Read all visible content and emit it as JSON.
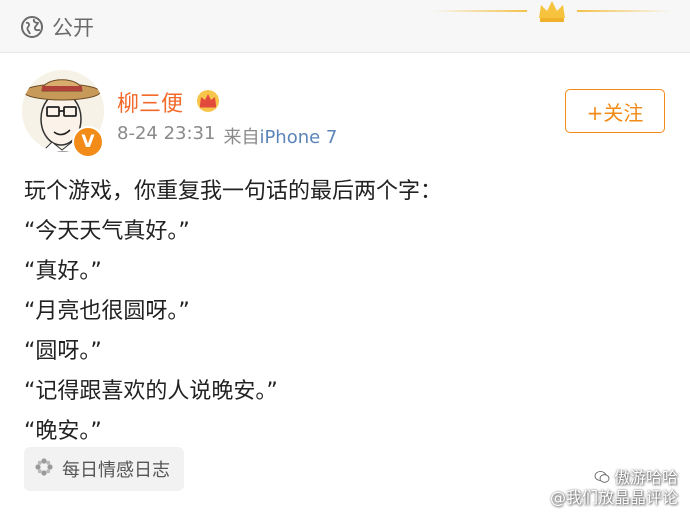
{
  "header": {
    "visibility_label": "公开",
    "visibility_icon": "globe-icon",
    "decor_icon": "crown-icon"
  },
  "post": {
    "author": {
      "name": "柳三便",
      "verified_badge": "V",
      "avatar": "avatar-cartoon-man-with-hat",
      "vip_icon": "crown-badge-icon"
    },
    "date": "8-24 23:31",
    "source": "来自",
    "device": "iPhone 7",
    "follow_label": "+关注",
    "content_lines": [
      "玩个游戏，你重复我一句话的最后两个字：",
      "“今天天气真好。”",
      "“真好。”",
      "“月亮也很圆呀。”",
      "“圆呀。”",
      "“记得跟喜欢的人说晚安。”",
      "“晚安。”"
    ],
    "topic_tag": "每日情感日志",
    "topic_icon": "pinwheel-icon"
  },
  "watermark": {
    "line1": "傲游哈哈",
    "line2": "@我们放晶晶评论"
  },
  "colors": {
    "accent": "#f28b18",
    "name": "#f26a2a",
    "link": "#5b84b8",
    "meta": "#8a8a8a"
  }
}
